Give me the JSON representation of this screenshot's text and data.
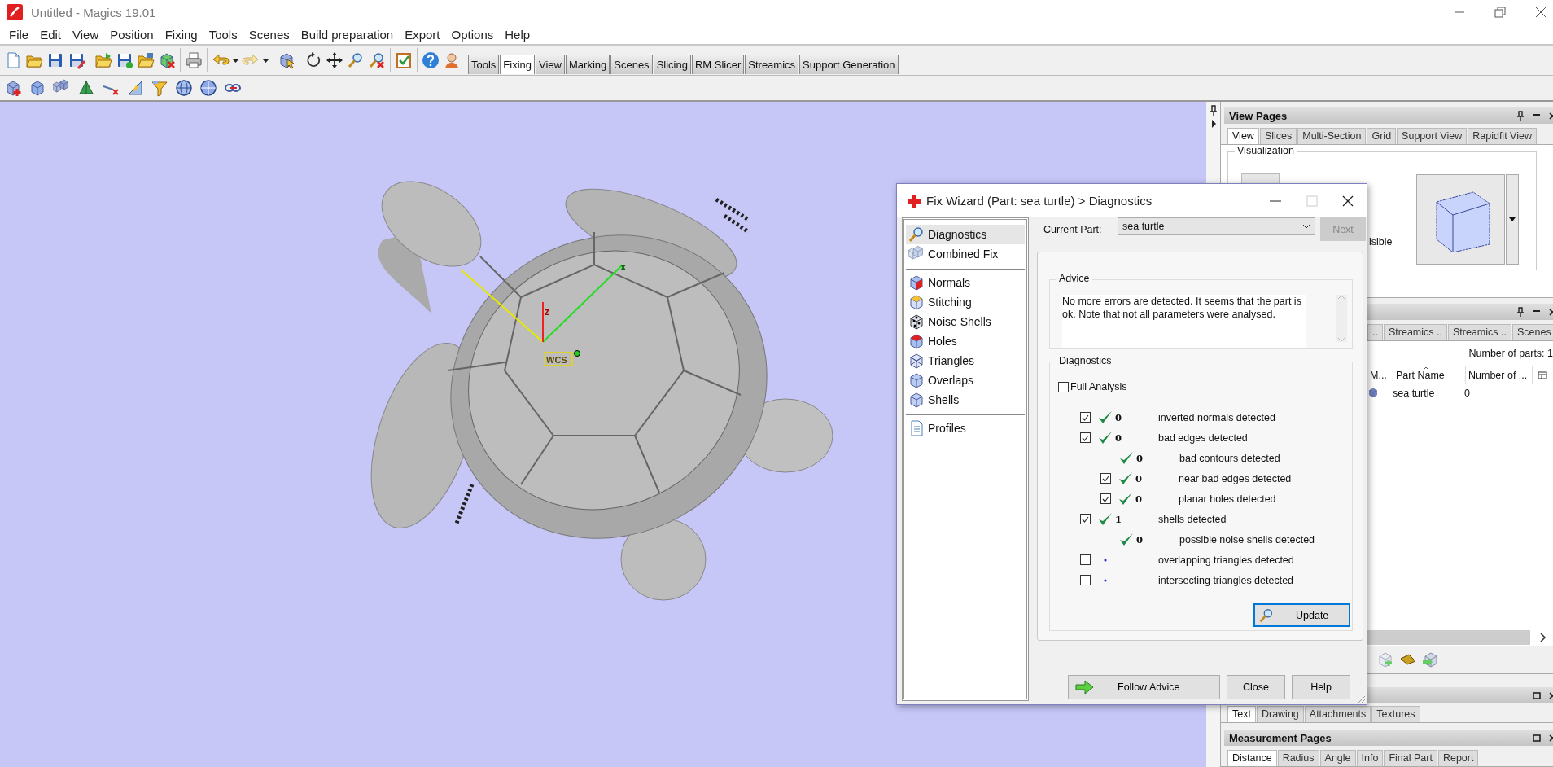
{
  "window": {
    "title": "Untitled - Magics 19.01"
  },
  "menu": [
    "File",
    "Edit",
    "View",
    "Position",
    "Fixing",
    "Tools",
    "Scenes",
    "Build preparation",
    "Export",
    "Options",
    "Help"
  ],
  "toolbar_tabs": [
    {
      "label": "Tools",
      "selected": false
    },
    {
      "label": "Fixing",
      "selected": true
    },
    {
      "label": "View",
      "selected": false
    },
    {
      "label": "Marking",
      "selected": false
    },
    {
      "label": "Scenes",
      "selected": false
    },
    {
      "label": "Slicing",
      "selected": false
    },
    {
      "label": "RM Slicer",
      "selected": false
    },
    {
      "label": "Streamics",
      "selected": false
    },
    {
      "label": "Support Generation",
      "selected": false
    }
  ],
  "viewport": {
    "axis_labels": {
      "x": "x",
      "z": "z",
      "origin": "WCS"
    }
  },
  "view_pages": {
    "title": "View Pages",
    "tabs": [
      {
        "label": "View",
        "selected": true
      },
      {
        "label": "Slices",
        "selected": false
      },
      {
        "label": "Multi-Section",
        "selected": false
      },
      {
        "label": "Grid",
        "selected": false
      },
      {
        "label": "Support View",
        "selected": false
      },
      {
        "label": "Rapidfit View",
        "selected": false
      }
    ],
    "group": "Visualization",
    "visible_label": "isible"
  },
  "parts_panel": {
    "tabs": [
      {
        "label": "..",
        "selected": false
      },
      {
        "label": "Streamics ..",
        "selected": false
      },
      {
        "label": "Streamics ..",
        "selected": false
      },
      {
        "label": "Scenes",
        "selected": false
      }
    ],
    "count": "Number of parts: 1",
    "columns": [
      "M...",
      "Part Name",
      "Number of ..."
    ],
    "rows": [
      {
        "name": "sea turtle",
        "value": "0"
      }
    ]
  },
  "annotation_panel": {
    "tabs": [
      {
        "label": "Text",
        "selected": true
      },
      {
        "label": "Drawing",
        "selected": false
      },
      {
        "label": "Attachments",
        "selected": false
      },
      {
        "label": "Textures",
        "selected": false
      }
    ]
  },
  "measurement_pages": {
    "title": "Measurement Pages",
    "tabs": [
      {
        "label": "Distance",
        "selected": true
      },
      {
        "label": "Radius",
        "selected": false
      },
      {
        "label": "Angle",
        "selected": false
      },
      {
        "label": "Info",
        "selected": false
      },
      {
        "label": "Final Part",
        "selected": false
      },
      {
        "label": "Report",
        "selected": false
      }
    ]
  },
  "dialog": {
    "title": "Fix Wizard (Part: sea turtle) > Diagnostics",
    "nav_groups": [
      {
        "items": [
          {
            "label": "Diagnostics",
            "selected": true
          },
          {
            "label": "Combined Fix",
            "selected": false
          }
        ]
      },
      {
        "items": [
          {
            "label": "Normals",
            "selected": false
          },
          {
            "label": "Stitching",
            "selected": false
          },
          {
            "label": "Noise Shells",
            "selected": false
          },
          {
            "label": "Holes",
            "selected": false
          },
          {
            "label": "Triangles",
            "selected": false
          },
          {
            "label": "Overlaps",
            "selected": false
          },
          {
            "label": "Shells",
            "selected": false
          }
        ]
      },
      {
        "items": [
          {
            "label": "Profiles",
            "selected": false
          }
        ]
      }
    ],
    "current_part_label": "Current Part:",
    "current_part": "sea turtle",
    "next_button": {
      "label": "Next",
      "disabled": true
    },
    "advice": {
      "title": "Advice",
      "text": "No more errors are detected. It seems that the part is ok. Note that not all parameters were analysed."
    },
    "diagnostics": {
      "title": "Diagnostics",
      "full_analysis": {
        "label": "Full Analysis",
        "checked": false
      },
      "rows": [
        {
          "kind": "checkbox",
          "checked": true,
          "passed": true,
          "count": "0",
          "label": "inverted normals detected"
        },
        {
          "kind": "checkbox",
          "checked": true,
          "passed": true,
          "count": "0",
          "label": "bad edges detected",
          "children": [
            {
              "kind": "plain",
              "passed": true,
              "count": "0",
              "label": "bad contours detected"
            },
            {
              "kind": "checkbox",
              "checked": true,
              "passed": true,
              "count": "0",
              "label": "near bad edges detected"
            },
            {
              "kind": "checkbox",
              "checked": true,
              "passed": true,
              "count": "0",
              "label": "planar holes detected"
            }
          ]
        },
        {
          "kind": "checkbox",
          "checked": true,
          "passed": true,
          "count": "1",
          "label": "shells detected",
          "children": [
            {
              "kind": "plain",
              "passed": true,
              "count": "0",
              "label": "possible noise shells detected"
            }
          ]
        },
        {
          "kind": "checkbox",
          "checked": false,
          "passed": false,
          "label": "overlapping triangles detected"
        },
        {
          "kind": "checkbox",
          "checked": false,
          "passed": false,
          "label": "intersecting triangles detected"
        }
      ],
      "update_button": "Update"
    },
    "buttons": [
      {
        "label": "Follow Advice",
        "kind": "advice"
      },
      {
        "label": "Close",
        "kind": "plain"
      },
      {
        "label": "Help",
        "kind": "plain"
      }
    ]
  }
}
